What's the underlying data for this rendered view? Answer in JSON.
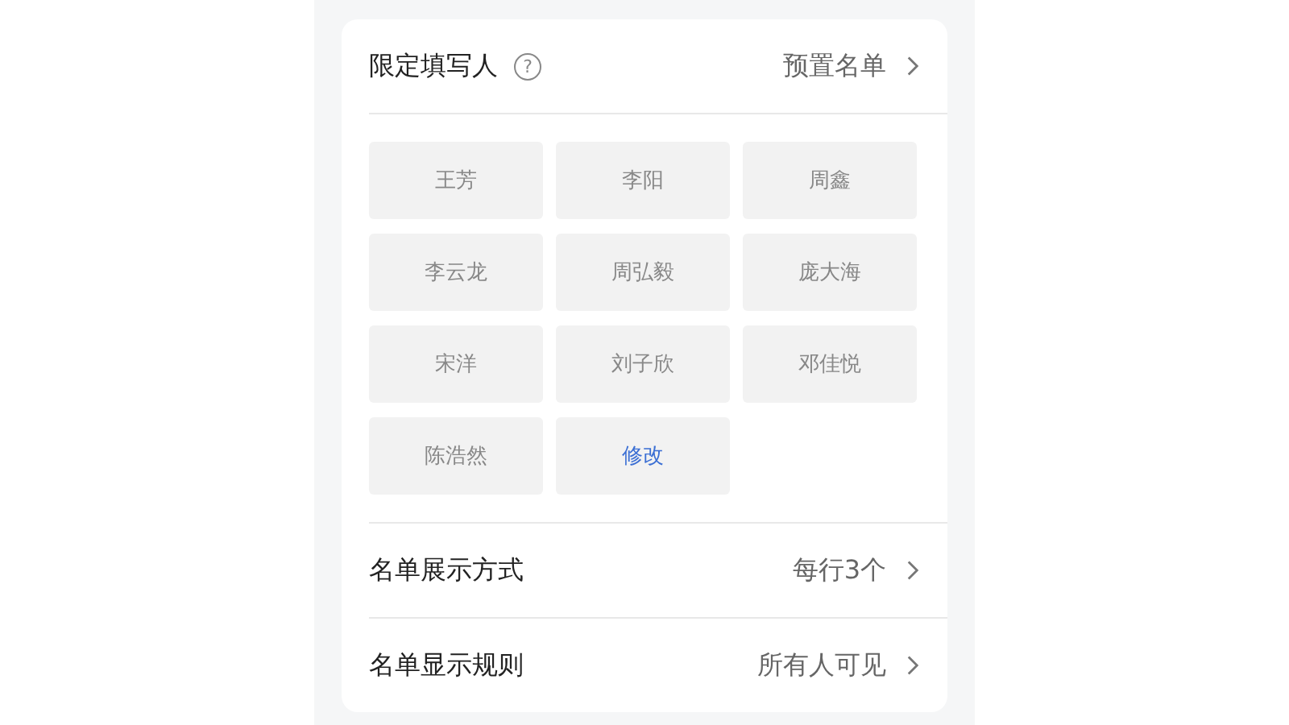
{
  "header": {
    "title": "限定填写人",
    "help": "?",
    "value": "预置名单"
  },
  "names": [
    {
      "label": "王芳",
      "kind": "name"
    },
    {
      "label": "李阳",
      "kind": "name"
    },
    {
      "label": "周鑫",
      "kind": "name"
    },
    {
      "label": "李云龙",
      "kind": "name"
    },
    {
      "label": "周弘毅",
      "kind": "name"
    },
    {
      "label": "庞大海",
      "kind": "name"
    },
    {
      "label": "宋洋",
      "kind": "name"
    },
    {
      "label": "刘子欣",
      "kind": "name"
    },
    {
      "label": "邓佳悦",
      "kind": "name"
    },
    {
      "label": "陈浩然",
      "kind": "name"
    },
    {
      "label": "修改",
      "kind": "action"
    }
  ],
  "settings": [
    {
      "label": "名单展示方式",
      "value": "每行3个"
    },
    {
      "label": "名单显示规则",
      "value": "所有人可见"
    }
  ]
}
